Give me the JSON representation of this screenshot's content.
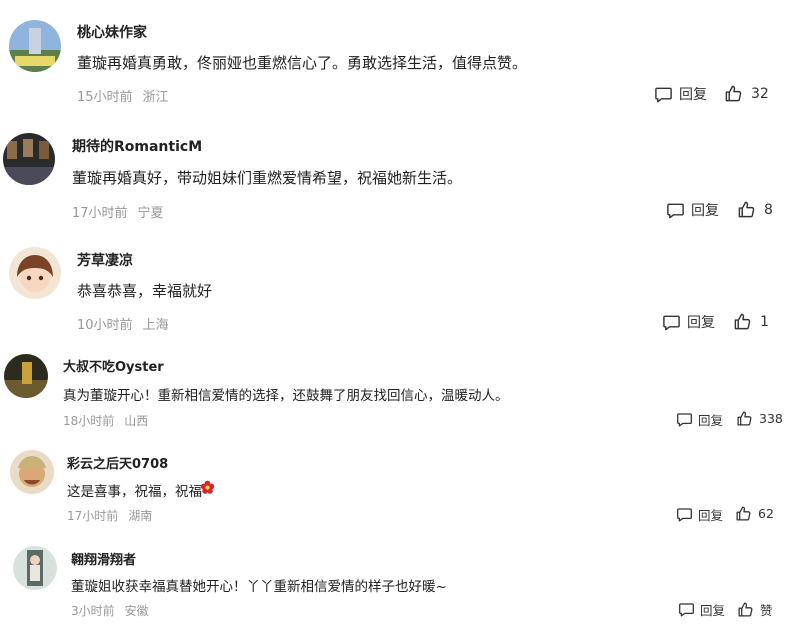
{
  "reply_label": "回复",
  "comments": [
    {
      "username": "桃心妹作家",
      "text": "董璇再婚真勇敢，佟丽娅也重燃信心了。勇敢选择生活，值得点赞。",
      "time": "15小时前",
      "location": "浙江",
      "likes": "32",
      "avatar_color": "#6a8fbf"
    },
    {
      "username": "期待的RomanticM",
      "text": "董璇再婚真好，带动姐妹们重燃爱情希望，祝福她新生活。",
      "time": "17小时前",
      "location": "宁夏",
      "likes": "8",
      "avatar_color": "#3a3a3a"
    },
    {
      "username": "芳草凄凉",
      "text": "恭喜恭喜，幸福就好",
      "time": "10小时前",
      "location": "上海",
      "likes": "1",
      "avatar_color": "#d6a27c"
    },
    {
      "username": "大叔不吃Oyster",
      "text": "真为董璇开心！重新相信爱情的选择，还鼓舞了朋友找回信心，温暖动人。",
      "time": "18小时前",
      "location": "山西",
      "likes": "338",
      "avatar_color": "#6b5a2e"
    },
    {
      "username": "彩云之后天0708",
      "text": "这是喜事，祝福，祝福",
      "time": "17小时前",
      "location": "湖南",
      "likes": "62",
      "avatar_color": "#b98a5c"
    },
    {
      "username": "翱翔滑翔者",
      "text": "董璇姐收获幸福真替她开心！丫丫重新相信爱情的样子也好暖~",
      "time": "3小时前",
      "location": "安徽",
      "likes": "赞",
      "avatar_color": "#8aa39a"
    }
  ]
}
